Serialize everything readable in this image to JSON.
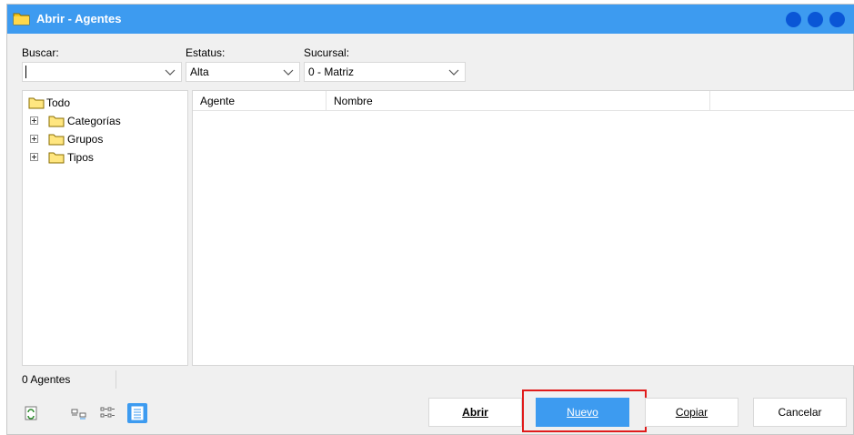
{
  "window": {
    "title": "Abrir - Agentes"
  },
  "filters": {
    "buscar_label": "Buscar:",
    "buscar_value": "",
    "estatus_label": "Estatus:",
    "estatus_value": "Alta",
    "sucursal_label": "Sucursal:",
    "sucursal_value": "0 - Matriz"
  },
  "tree": {
    "root": "Todo",
    "items": [
      {
        "label": "Categorías"
      },
      {
        "label": "Grupos"
      },
      {
        "label": "Tipos"
      }
    ]
  },
  "list": {
    "columns": [
      "Agente",
      "Nombre"
    ],
    "rows": []
  },
  "status": {
    "count_text": "0 Agentes"
  },
  "buttons": {
    "abrir": "Abrir",
    "nuevo": "Nuevo",
    "copiar": "Copiar",
    "cancelar": "Cancelar"
  },
  "colors": {
    "titlebar": "#3d9bf0",
    "window_dots": "#0a56d6",
    "highlight": "#e01b1b"
  },
  "icons": [
    "folder-icon",
    "chevron-down-icon",
    "refresh-icon",
    "small-icons-view-icon",
    "list-view-icon",
    "details-view-icon"
  ]
}
